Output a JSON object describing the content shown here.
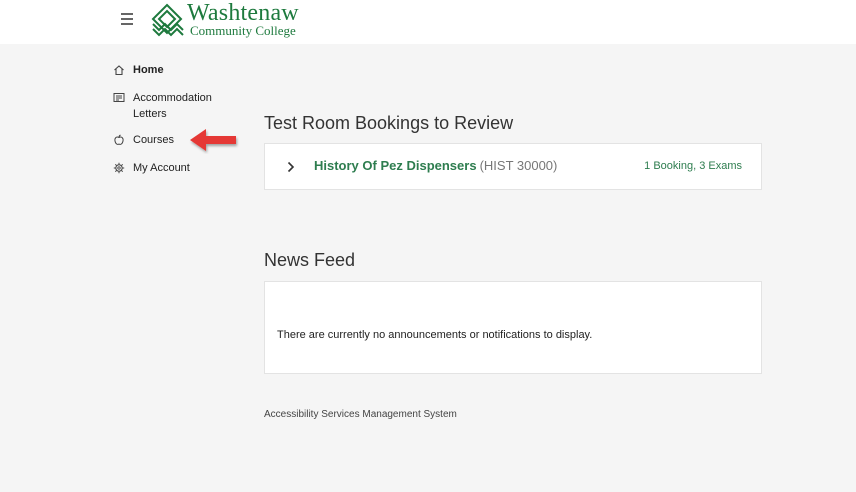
{
  "header": {
    "logo": {
      "name": "Washtenaw",
      "subtitle": "Community College"
    },
    "brand_color": "#1e7a3e"
  },
  "sidebar": {
    "items": [
      {
        "label": "Home",
        "icon": "home-icon",
        "active": true
      },
      {
        "label": "Accommodation Letters",
        "icon": "letter-icon",
        "active": false
      },
      {
        "label": "Courses",
        "icon": "apple-icon",
        "active": false
      },
      {
        "label": "My Account",
        "icon": "gear-icon",
        "active": false
      }
    ]
  },
  "annotation": {
    "icon": "red-arrow-icon",
    "color": "#e53935"
  },
  "bookings": {
    "title": "Test Room Bookings to Review",
    "items": [
      {
        "course_name": "History Of Pez Dispensers",
        "course_code": "(HIST 30000)",
        "summary": "1 Booking, 3 Exams"
      }
    ]
  },
  "news": {
    "title": "News Feed",
    "empty_message": "There are currently no announcements or notifications to display."
  },
  "footer": {
    "text": "Accessibility Services Management System"
  },
  "colors": {
    "link_green": "#2e7d4f",
    "background": "#f5f5f5"
  }
}
